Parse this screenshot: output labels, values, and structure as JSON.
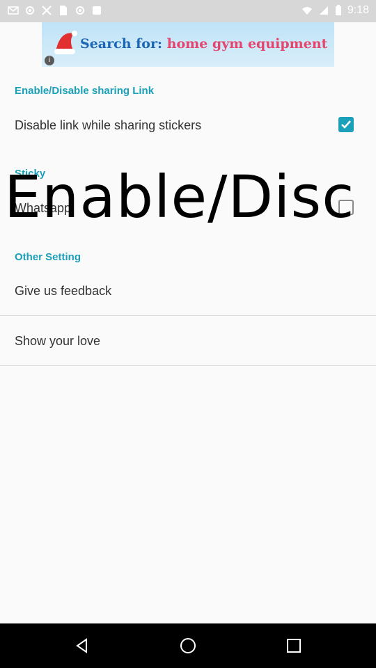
{
  "status_bar": {
    "time": "9:18"
  },
  "ad": {
    "prefix": "Search for:",
    "keyword": "home gym equipment",
    "info_glyph": "i"
  },
  "sections": {
    "sharing_link": {
      "title": "Enable/Disable sharing Link"
    },
    "sticky": {
      "title": "Sticky"
    },
    "other": {
      "title": "Other Setting"
    }
  },
  "rows": {
    "disable_link": {
      "label": "Disable link while sharing stickers",
      "checked": true
    },
    "whatsapp": {
      "label": "Whatsapp",
      "checked": false
    },
    "feedback": {
      "label": "Give us feedback"
    },
    "love": {
      "label": "Show your love"
    }
  },
  "overlay_text": "Enable/Disc",
  "colors": {
    "accent": "#1aa0b8",
    "status_bar": "#d7d7d7",
    "nav_bar": "#000000",
    "ad_keyword": "#e4466e",
    "ad_text": "#1c67b5"
  }
}
